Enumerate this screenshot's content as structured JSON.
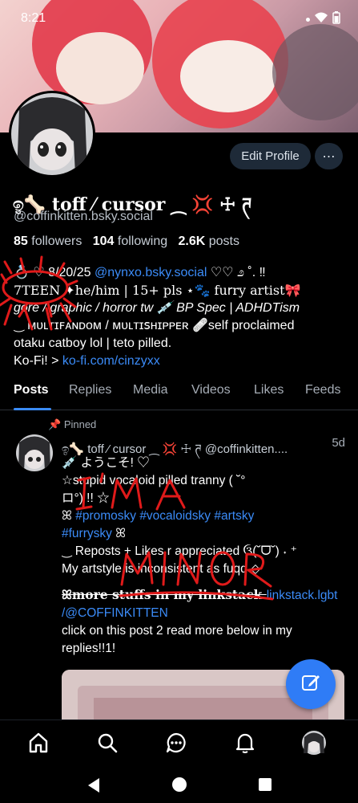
{
  "status": {
    "time": "8:21"
  },
  "profile": {
    "edit_label": "Edit Profile",
    "more_label": "⋯",
    "display_name": "ඉ🦴 toff ⁄ cursor ⁔ 💢 ☩ ཊ",
    "handle": "@coffinkitten.bsky.social",
    "followers_count": "85",
    "followers_label": "followers",
    "following_count": "104",
    "following_label": "following",
    "posts_count": "2.6K",
    "posts_label": "posts"
  },
  "bio": {
    "line1_prefix": "💍 ♡ 8/20/25 ",
    "line1_link": "@nynxo.bsky.social",
    "line1_suffix": " ♡♡ ೨ ˚. ‼",
    "line2": "7TEEN ✦he/him | 15+ pls ⋆🐾 fu𝗋ry artist🎀",
    "line3": "gore / graphic / horror tw 💉 BP Spec | ADHDTism",
    "line4": "‿ ᴍᴜʟᴛɪꜰᴀɴᴅᴏᴍ / ᴍᴜʟᴛɪꜱʜɪᴘᴘᴇʀ 🩹self proclaimed",
    "line5": "otaku catboy lol | teto pilled.",
    "line6_prefix": "Ko-Fi! > ",
    "line6_link": "ko-fi.com/cinzyxx"
  },
  "tabs": [
    "Posts",
    "Replies",
    "Media",
    "Videos",
    "Likes",
    "Feeds"
  ],
  "post": {
    "pinned_label": "Pinned",
    "author": "ඉ🦴 toff ⁄ cursor ⁔ 💢 ☩ ཊ @coffinkitten....",
    "time": "5d",
    "line1": "💉 ようこそ! ♡",
    "line2": "☆stupid vocaloid pilled tranny ( ˘°",
    "line3": "ロ°) !! ☆",
    "line4_prefix": "ꕤ ",
    "line4_link": "#promosky #vocaloidsky #artsky",
    "line5_link": "#furrysky",
    "line5_suffix": " ꕤ",
    "line6": "‿ Reposts + Likes r appreciated ઉ(˘ᗜ˘) ˖ ⁺",
    "line7": "My artstyle is inconsistent as fuqq ◇",
    "line8_prefix": "ꕤmore stuffs in my linkstack ",
    "line8_link": "linkstack.lgbt",
    "line9_link": "/@COFFINKITTEN",
    "line10": "click on this post 2 read more below in my",
    "line11": "replies!!1!"
  },
  "nav": {
    "home": "home-icon",
    "search": "search-icon",
    "chat": "chat-icon",
    "notifications": "bell-icon",
    "profile": "avatar"
  },
  "colors": {
    "accent": "#3b8bf7",
    "scribble": "#e01a1a",
    "background": "#000000"
  }
}
